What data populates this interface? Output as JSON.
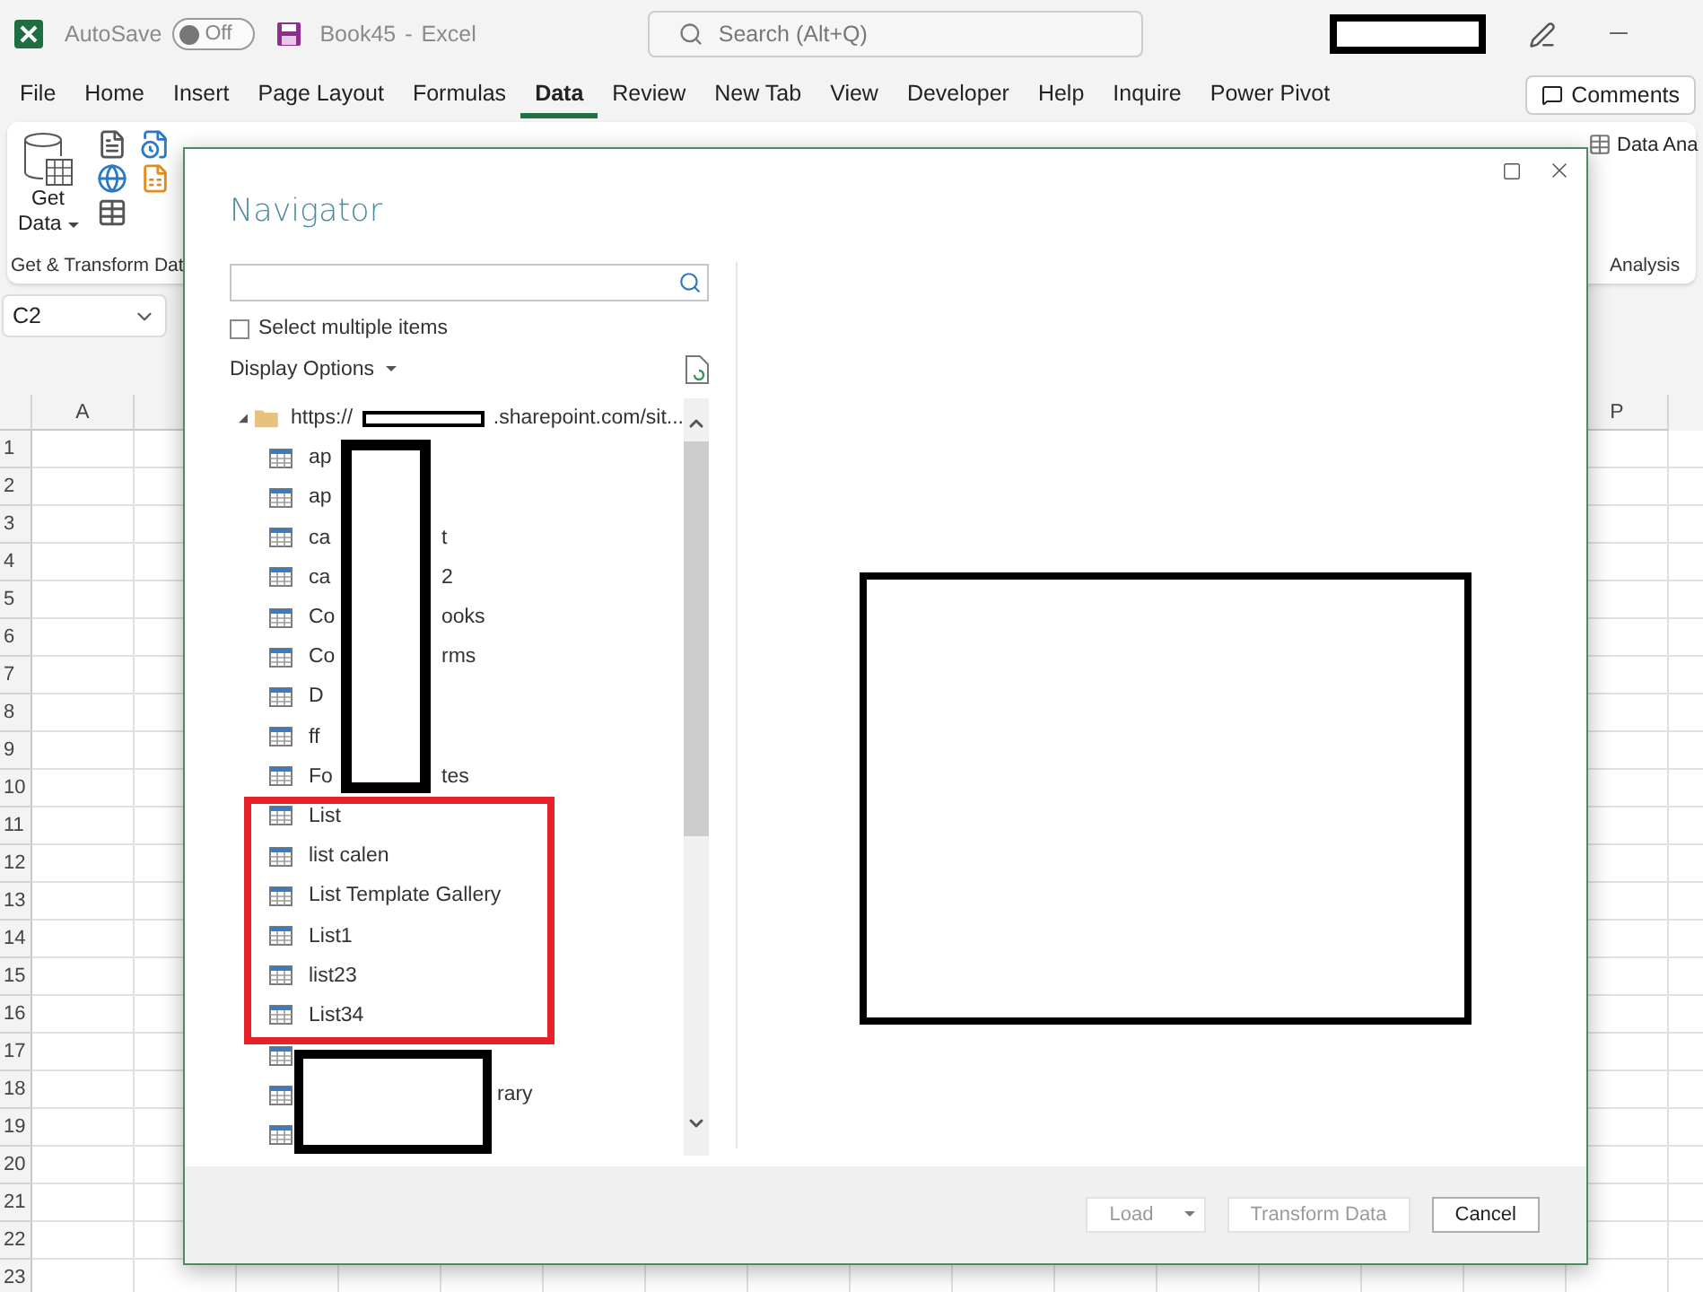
{
  "titlebar": {
    "autosave_label": "AutoSave",
    "autosave": {
      "label": "Off",
      "on": false
    },
    "file_name": "Book45",
    "separator": "-",
    "app_name": "Excel",
    "search": {
      "placeholder": "Search (Alt+Q)"
    }
  },
  "menu_tabs": [
    {
      "label": "File",
      "selected": false
    },
    {
      "label": "Home",
      "selected": false
    },
    {
      "label": "Insert",
      "selected": false
    },
    {
      "label": "Page Layout",
      "selected": false
    },
    {
      "label": "Formulas",
      "selected": false
    },
    {
      "label": "Data",
      "selected": true
    },
    {
      "label": "Review",
      "selected": false
    },
    {
      "label": "New Tab",
      "selected": false
    },
    {
      "label": "View",
      "selected": false
    },
    {
      "label": "Developer",
      "selected": false
    },
    {
      "label": "Help",
      "selected": false
    },
    {
      "label": "Inquire",
      "selected": false
    },
    {
      "label": "Power Pivot",
      "selected": false
    }
  ],
  "comments_button": "Comments",
  "ribbon": {
    "get_data": {
      "line1": "Get",
      "line2": "Data"
    },
    "group_label": "Get & Transform Dat",
    "data_analysis": "Data Ana",
    "analysis_group": "Analysis"
  },
  "name_box": "C2",
  "sheet": {
    "columns": [
      "A",
      "P"
    ],
    "rows": [
      "1",
      "2",
      "3",
      "4",
      "5",
      "6",
      "7",
      "8",
      "9",
      "10",
      "11",
      "12",
      "13",
      "14",
      "15",
      "16",
      "17",
      "18",
      "19",
      "20",
      "21",
      "22",
      "23"
    ]
  },
  "navigator": {
    "title": "Navigator",
    "select_multiple": {
      "label": "Select multiple items",
      "checked": false
    },
    "display_options": "Display Options",
    "root": {
      "head": "https://",
      "tail": ".sharepoint.com/sit...",
      "expanded": true
    },
    "items": [
      {
        "kind": "cut",
        "head": "ap"
      },
      {
        "kind": "cut",
        "head": "ap"
      },
      {
        "kind": "cut",
        "head": "ca",
        "tail": "t"
      },
      {
        "kind": "cut",
        "head": "ca",
        "tail": "2"
      },
      {
        "kind": "cut",
        "head": "Co",
        "tail": "ooks"
      },
      {
        "kind": "cut",
        "head": "Co",
        "tail": "rms"
      },
      {
        "kind": "cut",
        "head": "D"
      },
      {
        "kind": "cut",
        "head": "ff"
      },
      {
        "kind": "cut",
        "head": "Fo",
        "tail": "tes"
      },
      {
        "kind": "full",
        "text": "List"
      },
      {
        "kind": "full",
        "text": "list calen"
      },
      {
        "kind": "full",
        "text": "List Template Gallery"
      },
      {
        "kind": "full",
        "text": "List1"
      },
      {
        "kind": "full",
        "text": "list23"
      },
      {
        "kind": "full",
        "text": "List34"
      },
      {
        "kind": "icon"
      },
      {
        "kind": "tail",
        "tail": "rary"
      },
      {
        "kind": "icon"
      }
    ],
    "buttons": [
      {
        "label": "Load",
        "disabled": true,
        "kind": "split"
      },
      {
        "label": "Transform Data",
        "disabled": true,
        "kind": "plain"
      },
      {
        "label": "Cancel",
        "disabled": false,
        "kind": "plain"
      }
    ]
  }
}
